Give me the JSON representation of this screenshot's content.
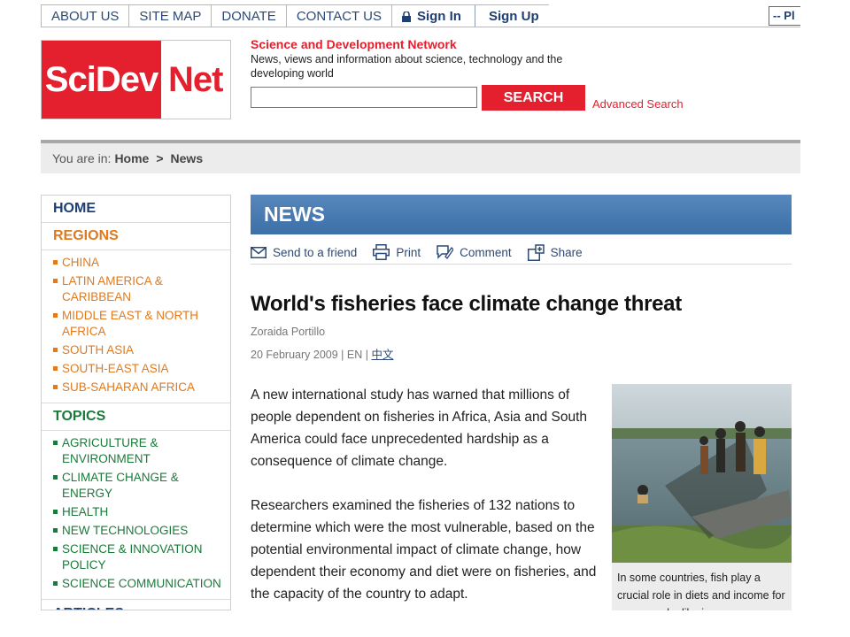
{
  "topnav": {
    "about": "ABOUT US",
    "sitemap": "SITE MAP",
    "donate": "DONATE",
    "contact": "CONTACT US",
    "signin": "Sign In",
    "signup": "Sign Up",
    "language_select": "-- Pl"
  },
  "logo": {
    "left": "SciDev",
    "right": "Net"
  },
  "header": {
    "title": "Science and Development Network",
    "description": "News, views and information about science, technology and the developing world",
    "search_value": "",
    "search_button": "SEARCH",
    "advanced_search": "Advanced Search"
  },
  "breadcrumb": {
    "prefix": "You are in:",
    "home": "Home",
    "separator": ">",
    "current": "News"
  },
  "sidebar": {
    "home": "HOME",
    "regions": {
      "heading": "REGIONS",
      "items": [
        "CHINA",
        "LATIN AMERICA & CARIBBEAN",
        "MIDDLE EAST & NORTH AFRICA",
        "SOUTH ASIA",
        "SOUTH-EAST ASIA",
        "SUB-SAHARAN AFRICA"
      ]
    },
    "topics": {
      "heading": "TOPICS",
      "items": [
        "AGRICULTURE & ENVIRONMENT",
        "CLIMATE CHANGE & ENERGY",
        "HEALTH",
        "NEW TECHNOLOGIES",
        "SCIENCE & INNOVATION POLICY",
        "SCIENCE COMMUNICATION"
      ]
    },
    "articles": "ARTICLES"
  },
  "section": {
    "title": "NEWS"
  },
  "tools": {
    "send": "Send to a friend",
    "print": "Print",
    "comment": "Comment",
    "share": "Share"
  },
  "article": {
    "headline": "World's fisheries face climate change threat",
    "author": "Zoraida Portillo",
    "date": "20 February 2009 | EN |",
    "alt_lang": "中文",
    "paragraphs": [
      "A new international study has warned that millions of people dependent on fisheries in Africa, Asia and South America could face unprecedented hardship as a consequence of climate change.",
      "Researchers examined the fisheries of 132 nations to determine which were the most vulnerable, based on the potential environmental impact of climate change, how dependent their economy and diet were on fisheries, and the capacity of the country to adapt."
    ],
    "caption": "In some countries, fish play a crucial role in diets and income for poor people, like in"
  },
  "colors": {
    "brand_red": "#e4202e",
    "nav_blue": "#1f3f73",
    "regions_orange": "#e07a1e",
    "topics_green": "#1a7a3a",
    "news_bar": "#3d6fa8"
  }
}
